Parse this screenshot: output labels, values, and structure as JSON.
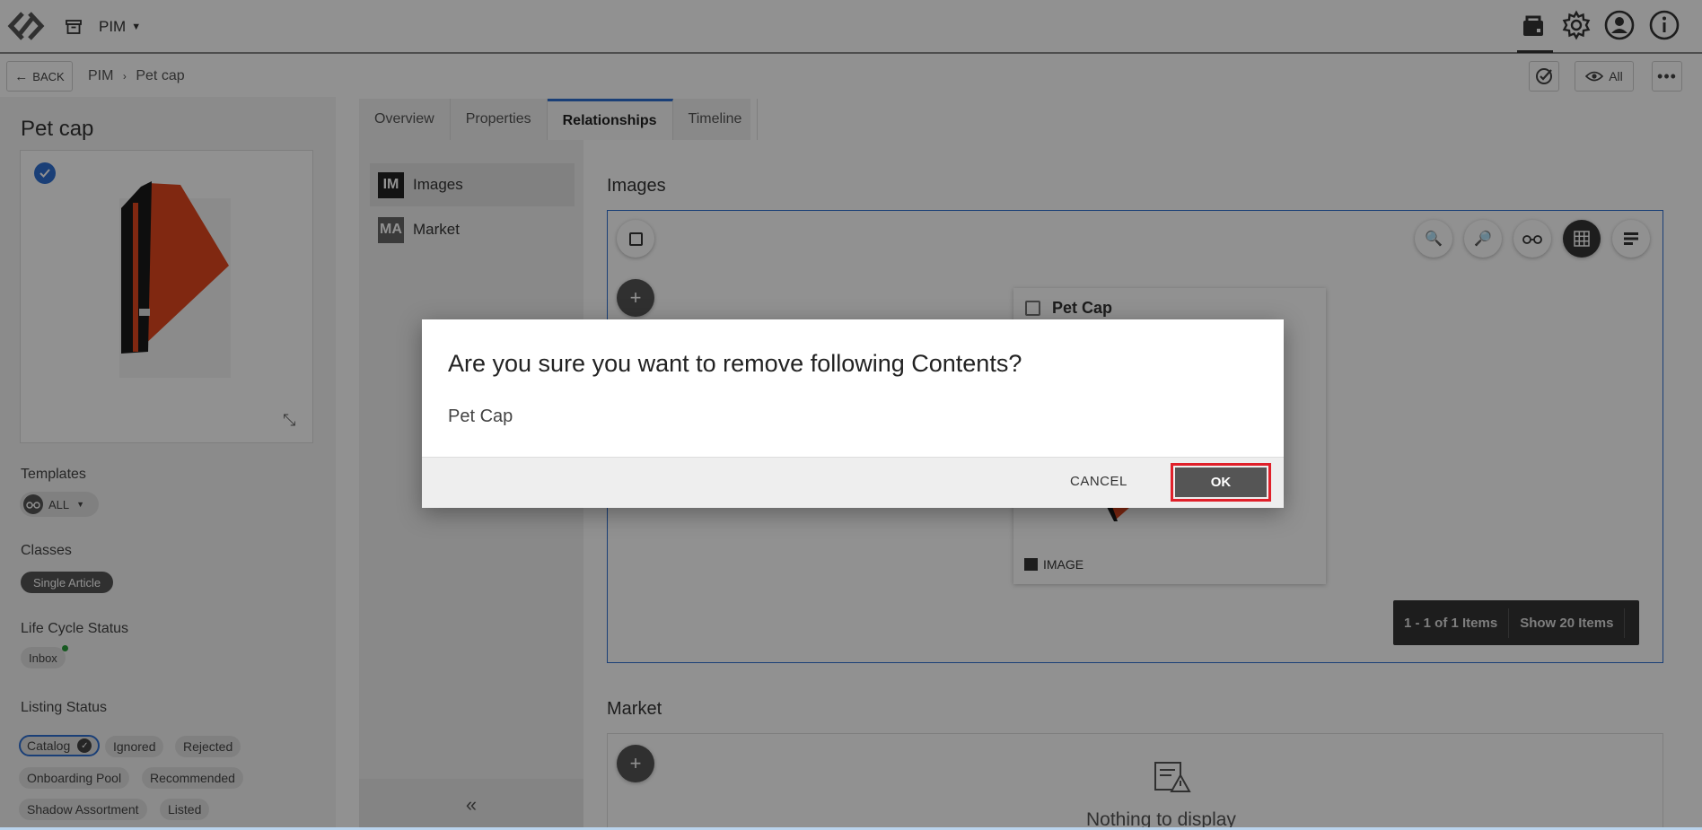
{
  "header": {
    "app_menu": "PIM"
  },
  "subheader": {
    "back_label": "BACK",
    "breadcrumb": [
      "PIM",
      "Pet cap"
    ],
    "view_label": "All"
  },
  "product": {
    "title": "Pet cap"
  },
  "sidebar": {
    "templates_label": "Templates",
    "templates_value": "ALL",
    "classes_label": "Classes",
    "classes": [
      "Single Article"
    ],
    "lifecycle_label": "Life Cycle Status",
    "lifecycle_value": "Inbox",
    "listing_label": "Listing Status",
    "listing": [
      "Catalog",
      "Ignored",
      "Rejected",
      "Onboarding Pool",
      "Recommended",
      "Shadow Assortment",
      "Listed"
    ]
  },
  "tabs": [
    "Overview",
    "Properties",
    "Relationships",
    "Timeline"
  ],
  "active_tab": "Relationships",
  "relations": [
    {
      "badge": "IM",
      "label": "Images"
    },
    {
      "badge": "MA",
      "label": "Market"
    }
  ],
  "images_section": {
    "title": "Images",
    "card": {
      "title": "Pet Cap",
      "type": "IMAGE"
    },
    "pagination": {
      "range": "1 - 1 of 1 Items",
      "page_size": "Show 20 Items"
    }
  },
  "market_section": {
    "title": "Market",
    "empty": "Nothing to display"
  },
  "dialog": {
    "title": "Are you sure you want to remove following Contents?",
    "item": "Pet Cap",
    "cancel": "CANCEL",
    "ok": "OK"
  },
  "colors": {
    "accent": "#2f6fd1",
    "dialog_highlight": "#e0202a",
    "ok_button": "#555555",
    "overlay": "rgba(0,0,0,0.43)"
  }
}
